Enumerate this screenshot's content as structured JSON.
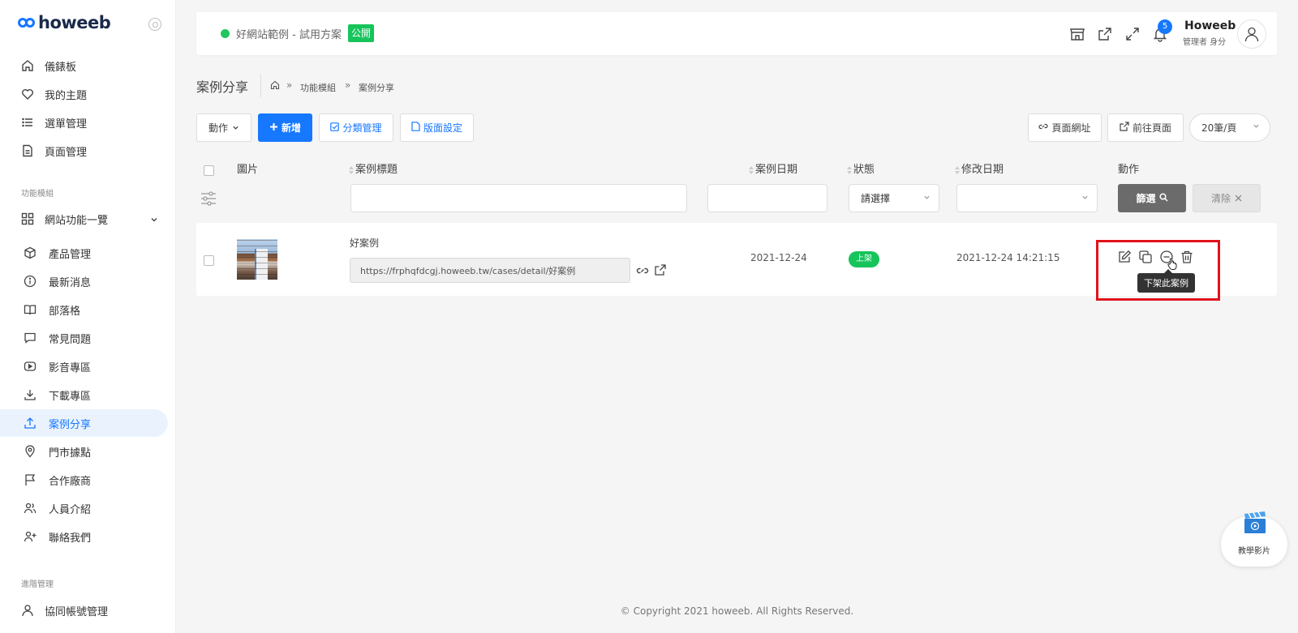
{
  "brand": {
    "logo_text": "howeeb"
  },
  "sidebar": {
    "items": [
      {
        "label": "儀錶板",
        "icon": "home-icon"
      },
      {
        "label": "我的主題",
        "icon": "heart-icon"
      },
      {
        "label": "選單管理",
        "icon": "list-icon"
      },
      {
        "label": "頁面管理",
        "icon": "file-icon"
      }
    ],
    "section_modules": "功能模組",
    "modules_group": {
      "label": "網站功能一覽",
      "icon": "grid-icon"
    },
    "module_items": [
      {
        "label": "產品管理",
        "icon": "box-icon"
      },
      {
        "label": "最新消息",
        "icon": "info-icon"
      },
      {
        "label": "部落格",
        "icon": "book-icon"
      },
      {
        "label": "常見問題",
        "icon": "chat-icon"
      },
      {
        "label": "影音專區",
        "icon": "video-icon"
      },
      {
        "label": "下載專區",
        "icon": "download-icon"
      },
      {
        "label": "案例分享",
        "icon": "share-icon",
        "active": true
      },
      {
        "label": "門市據點",
        "icon": "location-icon"
      },
      {
        "label": "合作廠商",
        "icon": "flag-icon"
      },
      {
        "label": "人員介紹",
        "icon": "users-icon"
      },
      {
        "label": "聯絡我們",
        "icon": "user-plus-icon"
      }
    ],
    "section_advanced": "進階管理",
    "advanced_items": [
      {
        "label": "協同帳號管理",
        "icon": "user-icon"
      }
    ]
  },
  "topbar": {
    "site_name": "好網站範例 - 試用方案",
    "public_badge": "公開",
    "notification_count": "5",
    "user_name": "Howeeb",
    "user_role": "管理者 身分"
  },
  "page": {
    "title": "案例分享",
    "breadcrumb": [
      "功能模組",
      "案例分享"
    ]
  },
  "toolbar": {
    "action_label": "動作",
    "add_label": "新增",
    "category_label": "分類管理",
    "layout_label": "版面設定",
    "page_url_label": "頁面網址",
    "goto_page_label": "前往頁面",
    "per_page": "20筆/頁"
  },
  "table": {
    "headers": {
      "image": "圖片",
      "title": "案例標題",
      "date": "案例日期",
      "status": "狀態",
      "modified": "修改日期",
      "actions": "動作"
    },
    "filters": {
      "status_placeholder": "請選擇",
      "filter_button": "篩選",
      "clear_button": "清除"
    },
    "rows": [
      {
        "title": "好案例",
        "url": "https://frphqfdcgj.howeeb.tw/cases/detail/好案例",
        "date": "2021-12-24",
        "status": "上架",
        "modified": "2021-12-24 14:21:15"
      }
    ],
    "tooltip": "下架此案例"
  },
  "footer": {
    "copyright": "© Copyright 2021 howeeb. All Rights Reserved."
  },
  "widget": {
    "label": "教學影片"
  },
  "colors": {
    "primary": "#1677ff",
    "success": "#16c45b",
    "highlight": "#e0121c"
  }
}
